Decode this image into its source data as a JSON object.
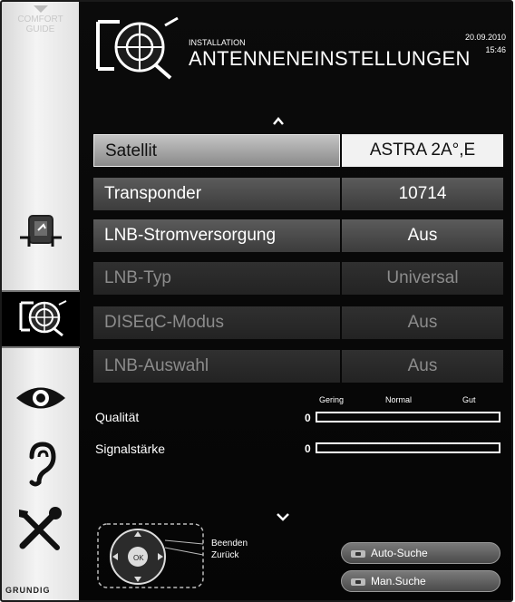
{
  "sidebar": {
    "comfort_guide_line1": "COMFORT",
    "comfort_guide_line2": "GUIDE",
    "brand": "GRUNDIG",
    "icons": [
      "source-icon",
      "antenna-settings-icon",
      "eye-icon",
      "ear-icon",
      "tools-icon"
    ],
    "active_icon": "antenna-settings-icon"
  },
  "header": {
    "section": "INSTALLATION",
    "title": "ANTENNENEINSTELLUNGEN",
    "date": "20.09.2010",
    "time": "15:46"
  },
  "menu": {
    "rows": [
      {
        "label": "Satellit",
        "value": "ASTRA 2A°,E",
        "state": "selected"
      },
      {
        "label": "Transponder",
        "value": "10714",
        "state": "normal"
      },
      {
        "label": "LNB-Stromversorgung",
        "value": "Aus",
        "state": "normal"
      },
      {
        "label": "LNB-Typ",
        "value": "Universal",
        "state": "disabled"
      },
      {
        "label": "DISEqC-Modus",
        "value": "Aus",
        "state": "disabled"
      },
      {
        "label": "LNB-Auswahl",
        "value": "Aus",
        "state": "disabled"
      }
    ]
  },
  "meters": {
    "scale": {
      "low": "Gering",
      "mid": "Normal",
      "high": "Gut"
    },
    "quality": {
      "label": "Qualität",
      "value": "0",
      "fill": 0
    },
    "signal": {
      "label": "Signalstärke",
      "value": "0",
      "fill": 0
    }
  },
  "footer": {
    "beenden": "Beenden",
    "zurueck": "Zurück",
    "auto_search": "Auto-Suche",
    "man_search": "Man.Suche"
  }
}
